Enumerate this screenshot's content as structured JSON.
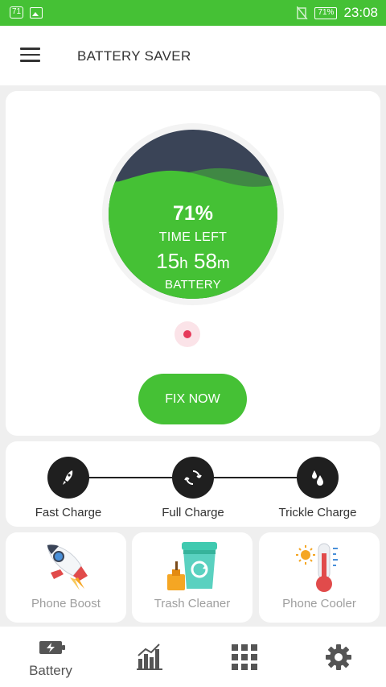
{
  "status_bar": {
    "notif_badge": "71",
    "battery_text": "71%",
    "time": "23:08"
  },
  "app_bar": {
    "title": "BATTERY SAVER"
  },
  "gauge": {
    "percent_text": "71%",
    "time_left_label": "TIME LEFT",
    "hours": "15",
    "hours_unit": "h",
    "minutes": "58",
    "minutes_unit": "m",
    "battery_label": "BATTERY",
    "level": 0.71,
    "fill_color": "#45c135",
    "empty_color": "#3a4457"
  },
  "fix_button": {
    "label": "FIX NOW"
  },
  "charge_modes": [
    {
      "label": "Fast Charge",
      "icon": "rocket-icon"
    },
    {
      "label": "Full Charge",
      "icon": "cycle-icon"
    },
    {
      "label": "Trickle Charge",
      "icon": "droplets-icon"
    }
  ],
  "tools": [
    {
      "label": "Phone Boost",
      "icon": "rocket-icon"
    },
    {
      "label": "Trash Cleaner",
      "icon": "trash-cleaner-icon"
    },
    {
      "label": "Phone Cooler",
      "icon": "thermometer-icon"
    }
  ],
  "bottom_nav": [
    {
      "label": "Battery",
      "icon": "battery-icon"
    },
    {
      "label": "",
      "icon": "stats-icon"
    },
    {
      "label": "",
      "icon": "apps-grid-icon"
    },
    {
      "label": "",
      "icon": "gear-icon"
    }
  ],
  "colors": {
    "accent": "#45c135",
    "alert": "#e63a5a"
  }
}
